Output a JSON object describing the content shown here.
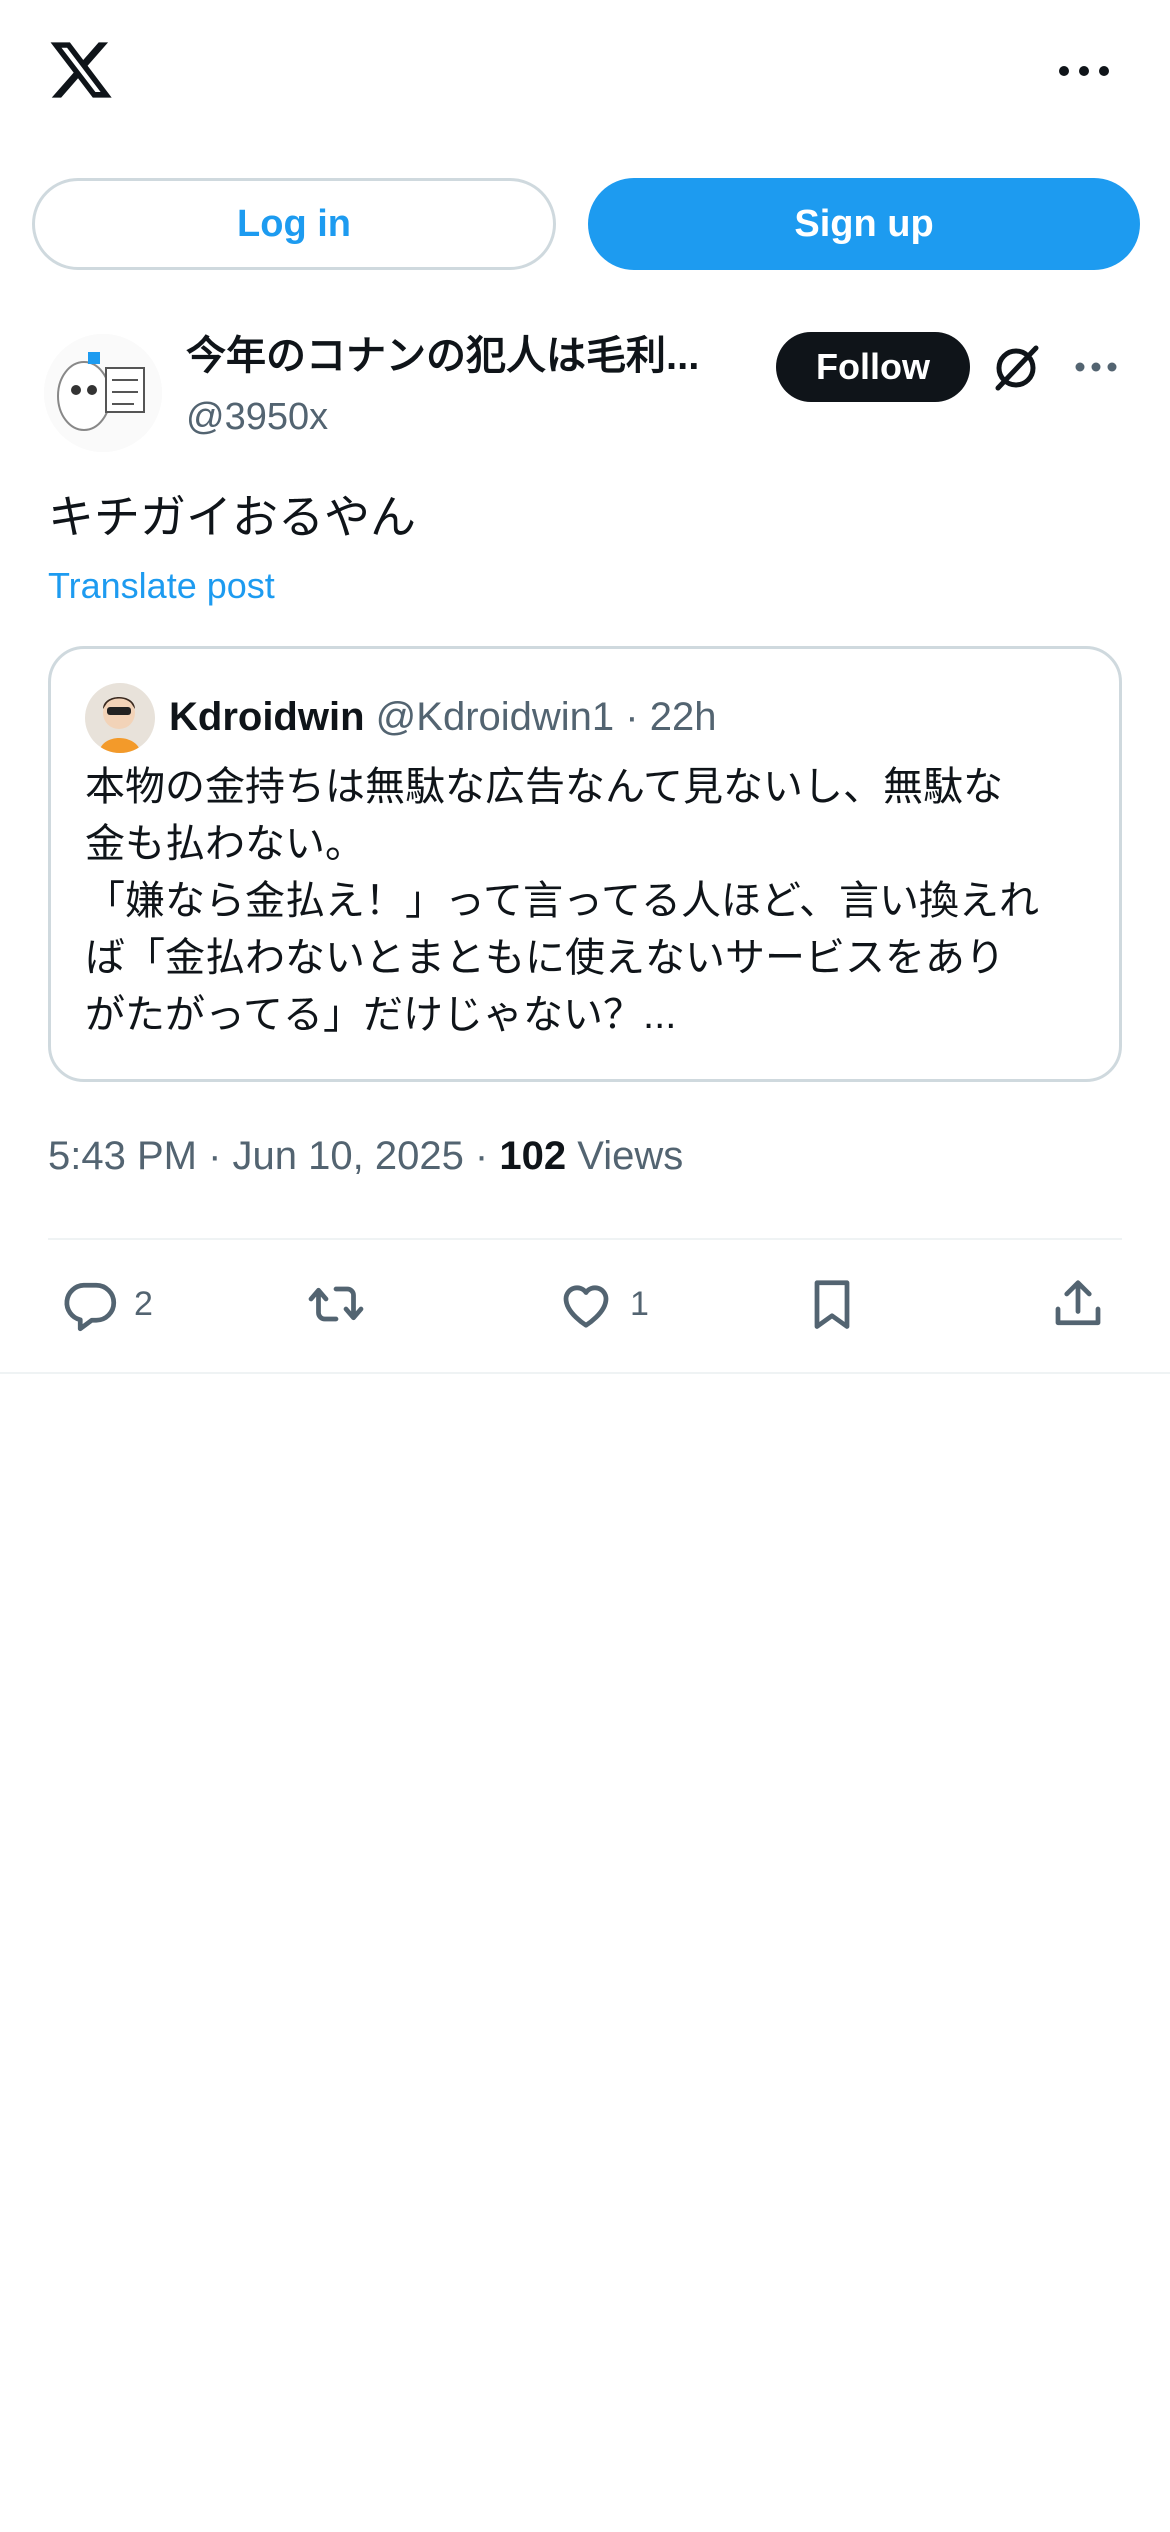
{
  "app": {
    "logo_icon": "x-logo-icon",
    "more_icon": "more-horizontal-icon"
  },
  "auth": {
    "login_label": "Log in",
    "signup_label": "Sign up"
  },
  "post": {
    "author_name": "今年のコナンの犯人は毛利...",
    "author_handle": "@3950x",
    "follow_label": "Follow",
    "text": "キチガイおるやん",
    "translate_label": "Translate post",
    "quote": {
      "name": "Kdroidwin",
      "handle_time": "@Kdroidwin1 · 22h",
      "text": "本物の金持ちは無駄な広告なんて見ないし、無駄な\n金も払わない。\n「嫌なら金払え！」って言ってる人ほど、言い換えれ\nば「金払わないとまともに使えないサービスをあり\nがたがってる」だけじゃない？..."
    },
    "timestamp": "5:43 PM · Jun 10, 2025 · ",
    "views_count": "102",
    "views_label": " Views",
    "actions": {
      "reply_count": "2",
      "repost_count": "",
      "like_count": "1"
    }
  },
  "colors": {
    "accent": "#1d9bf0",
    "text_primary": "#0f1419",
    "text_secondary": "#536471",
    "border": "#cfd9de"
  }
}
